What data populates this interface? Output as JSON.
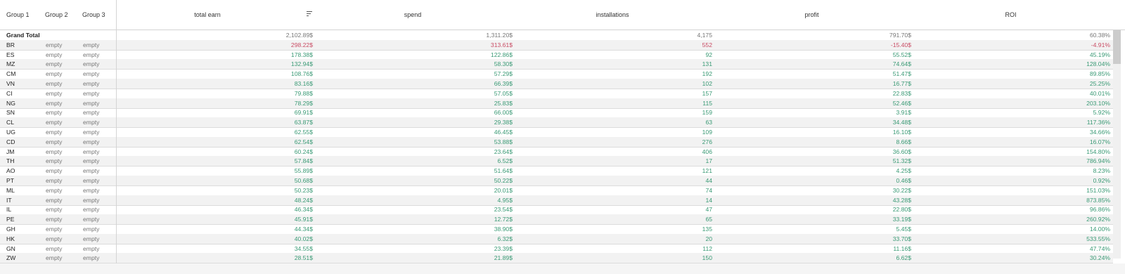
{
  "headers": {
    "group1": "Group 1",
    "group2": "Group 2",
    "group3": "Group 3",
    "total_earn": "total earn",
    "spend": "spend",
    "installations": "installations",
    "profit": "profit",
    "roi": "ROI"
  },
  "sort_icon": "sort-descending-icon",
  "colors": {
    "positive": "#3a9a75",
    "negative": "#c94c64",
    "neutral": "#777777"
  },
  "grand_total": {
    "label": "Grand Total",
    "total_earn": "2,102.89$",
    "spend": "1,311.20$",
    "installations": "4,175",
    "profit": "791.70$",
    "roi": "60.38%"
  },
  "rows": [
    {
      "g1": "BR",
      "g2": "empty",
      "g3": "empty",
      "earn": "298.22$",
      "spend": "313.61$",
      "inst": "552",
      "profit": "-15.40$",
      "roi": "-4.91%",
      "neg": true
    },
    {
      "g1": "ES",
      "g2": "empty",
      "g3": "empty",
      "earn": "178.38$",
      "spend": "122.86$",
      "inst": "92",
      "profit": "55.52$",
      "roi": "45.19%"
    },
    {
      "g1": "MZ",
      "g2": "empty",
      "g3": "empty",
      "earn": "132.94$",
      "spend": "58.30$",
      "inst": "131",
      "profit": "74.64$",
      "roi": "128.04%"
    },
    {
      "g1": "CM",
      "g2": "empty",
      "g3": "empty",
      "earn": "108.76$",
      "spend": "57.29$",
      "inst": "192",
      "profit": "51.47$",
      "roi": "89.85%"
    },
    {
      "g1": "VN",
      "g2": "empty",
      "g3": "empty",
      "earn": "83.16$",
      "spend": "66.39$",
      "inst": "102",
      "profit": "16.77$",
      "roi": "25.25%"
    },
    {
      "g1": "CI",
      "g2": "empty",
      "g3": "empty",
      "earn": "79.88$",
      "spend": "57.05$",
      "inst": "157",
      "profit": "22.83$",
      "roi": "40.01%"
    },
    {
      "g1": "NG",
      "g2": "empty",
      "g3": "empty",
      "earn": "78.29$",
      "spend": "25.83$",
      "inst": "115",
      "profit": "52.46$",
      "roi": "203.10%"
    },
    {
      "g1": "SN",
      "g2": "empty",
      "g3": "empty",
      "earn": "69.91$",
      "spend": "66.00$",
      "inst": "159",
      "profit": "3.91$",
      "roi": "5.92%"
    },
    {
      "g1": "CL",
      "g2": "empty",
      "g3": "empty",
      "earn": "63.87$",
      "spend": "29.38$",
      "inst": "63",
      "profit": "34.48$",
      "roi": "117.36%"
    },
    {
      "g1": "UG",
      "g2": "empty",
      "g3": "empty",
      "earn": "62.55$",
      "spend": "46.45$",
      "inst": "109",
      "profit": "16.10$",
      "roi": "34.66%"
    },
    {
      "g1": "CD",
      "g2": "empty",
      "g3": "empty",
      "earn": "62.54$",
      "spend": "53.88$",
      "inst": "276",
      "profit": "8.66$",
      "roi": "16.07%"
    },
    {
      "g1": "JM",
      "g2": "empty",
      "g3": "empty",
      "earn": "60.24$",
      "spend": "23.64$",
      "inst": "406",
      "profit": "36.60$",
      "roi": "154.80%"
    },
    {
      "g1": "TH",
      "g2": "empty",
      "g3": "empty",
      "earn": "57.84$",
      "spend": "6.52$",
      "inst": "17",
      "profit": "51.32$",
      "roi": "786.94%"
    },
    {
      "g1": "AO",
      "g2": "empty",
      "g3": "empty",
      "earn": "55.89$",
      "spend": "51.64$",
      "inst": "121",
      "profit": "4.25$",
      "roi": "8.23%"
    },
    {
      "g1": "PT",
      "g2": "empty",
      "g3": "empty",
      "earn": "50.68$",
      "spend": "50.22$",
      "inst": "44",
      "profit": "0.46$",
      "roi": "0.92%"
    },
    {
      "g1": "ML",
      "g2": "empty",
      "g3": "empty",
      "earn": "50.23$",
      "spend": "20.01$",
      "inst": "74",
      "profit": "30.22$",
      "roi": "151.03%"
    },
    {
      "g1": "IT",
      "g2": "empty",
      "g3": "empty",
      "earn": "48.24$",
      "spend": "4.95$",
      "inst": "14",
      "profit": "43.28$",
      "roi": "873.85%"
    },
    {
      "g1": "IL",
      "g2": "empty",
      "g3": "empty",
      "earn": "46.34$",
      "spend": "23.54$",
      "inst": "47",
      "profit": "22.80$",
      "roi": "96.86%"
    },
    {
      "g1": "PE",
      "g2": "empty",
      "g3": "empty",
      "earn": "45.91$",
      "spend": "12.72$",
      "inst": "65",
      "profit": "33.19$",
      "roi": "260.92%"
    },
    {
      "g1": "GH",
      "g2": "empty",
      "g3": "empty",
      "earn": "44.34$",
      "spend": "38.90$",
      "inst": "135",
      "profit": "5.45$",
      "roi": "14.00%"
    },
    {
      "g1": "HK",
      "g2": "empty",
      "g3": "empty",
      "earn": "40.02$",
      "spend": "6.32$",
      "inst": "20",
      "profit": "33.70$",
      "roi": "533.55%"
    },
    {
      "g1": "GN",
      "g2": "empty",
      "g3": "empty",
      "earn": "34.55$",
      "spend": "23.39$",
      "inst": "112",
      "profit": "11.16$",
      "roi": "47.74%"
    },
    {
      "g1": "ZW",
      "g2": "empty",
      "g3": "empty",
      "earn": "28.51$",
      "spend": "21.89$",
      "inst": "150",
      "profit": "6.62$",
      "roi": "30.24%"
    }
  ]
}
